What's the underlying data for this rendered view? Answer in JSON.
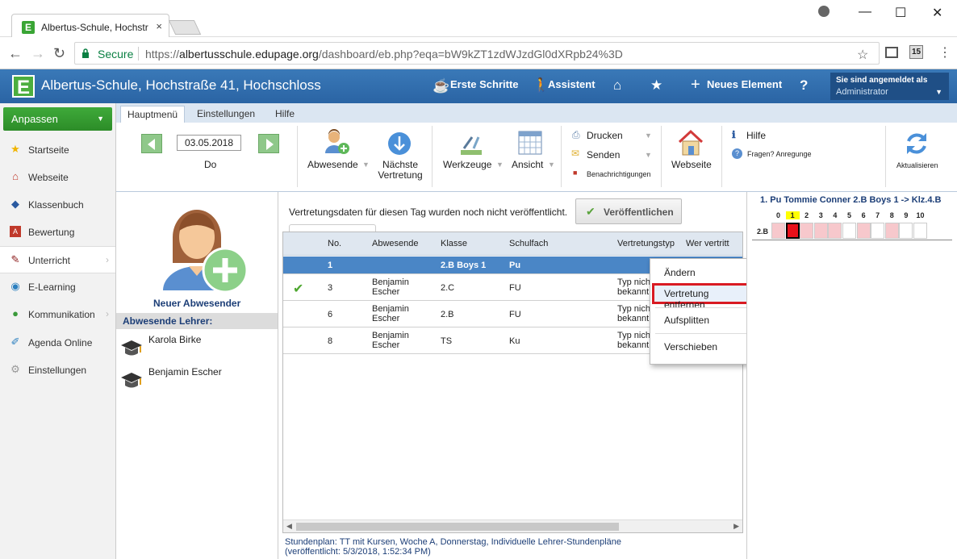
{
  "browser": {
    "tab_title": "Albertus-Schule, Hochstr",
    "tab_close": "×",
    "secure_label": "Secure",
    "url_scheme": "https://",
    "url_host": "albertusschule.edupage.org",
    "url_path": "/dashboard/eb.php?eqa=bW9kZT1zdWJzdGl0dXRpb24%3D",
    "extension_badge": "15",
    "window_controls": [
      "—",
      "☐",
      "✕"
    ]
  },
  "app_header": {
    "school_name": "Albertus-Schule, Hochstraße 41, Hochschloss",
    "logo_letter": "E",
    "nav": [
      "Erste Schritte",
      "Assistent",
      "Neues Element"
    ],
    "login_line1": "Sie sind angemeldet als",
    "login_line2": "Administrator",
    "help_icon": "?"
  },
  "sidebar": {
    "button_label": "Anpassen",
    "items": [
      {
        "label": "Startseite",
        "icon": "star-icon"
      },
      {
        "label": "Webseite",
        "icon": "website-icon"
      },
      {
        "label": "Klassenbuch",
        "icon": "book-icon"
      },
      {
        "label": "Bewertung",
        "icon": "grade-icon"
      },
      {
        "label": "Unterricht",
        "icon": "teaching-icon"
      },
      {
        "label": "E-Learning",
        "icon": "elearning-icon"
      },
      {
        "label": "Kommunikation",
        "icon": "communication-icon"
      },
      {
        "label": "Agenda Online",
        "icon": "agenda-icon"
      },
      {
        "label": "Einstellungen",
        "icon": "settings-icon"
      }
    ]
  },
  "ribbon": {
    "tabs": [
      "Hauptmenü",
      "Einstellungen",
      "Hilfe"
    ],
    "date": "03.05.2018",
    "day": "Do",
    "abwesende": "Abwesende",
    "naechste_line1": "Nächste",
    "naechste_line2": "Vertretung",
    "werkzeuge": "Werkzeuge",
    "ansicht": "Ansicht",
    "drucken": "Drucken",
    "senden": "Senden",
    "benachrichtigungen": "Benachrichtigungen",
    "webseite": "Webseite",
    "hilfe": "Hilfe",
    "fragen": "Fragen? Anregunge",
    "aktualisieren": "Aktualisieren"
  },
  "absent_panel": {
    "new_label": "Neuer Abwesender",
    "header": "Abwesende Lehrer:",
    "teachers": [
      "Karola Birke",
      "Benjamin Escher"
    ]
  },
  "center": {
    "notice": "Vertretungsdaten für diesen Tag wurden noch nicht veröffentlicht.",
    "publish_button": "Veröffentlichen",
    "columns": [
      "No.",
      "Abwesende",
      "Klasse",
      "Schulfach",
      "Vertretungstyp",
      "Wer vertritt"
    ],
    "rows": [
      {
        "no": "1",
        "abwesende_1": "",
        "abwesende_2": "",
        "klasse": "2.B Boys 1",
        "fach": "Pu",
        "typ_1": "",
        "typ_2": "",
        "checked": false,
        "selected": true
      },
      {
        "no": "3",
        "abwesende_1": "Benjamin",
        "abwesende_2": "Escher",
        "klasse": "2.C",
        "fach": "FU",
        "typ_1": "Typ nicht",
        "typ_2": "bekannt",
        "checked": true,
        "selected": false
      },
      {
        "no": "6",
        "abwesende_1": "Benjamin",
        "abwesende_2": "Escher",
        "klasse": "2.B",
        "fach": "FU",
        "typ_1": "Typ nicht",
        "typ_2": "bekannt",
        "checked": false,
        "selected": false
      },
      {
        "no": "8",
        "abwesende_1": "Benjamin",
        "abwesende_2": "Escher",
        "klasse": "TS",
        "fach": "Ku",
        "typ_1": "Typ nicht",
        "typ_2": "bekannt",
        "checked": false,
        "selected": false
      }
    ],
    "footer_line1": "Stundenplan: TT mit Kursen, Woche A, Donnerstag, Individuelle Lehrer-Stundenpläne",
    "footer_line2": "(veröffentlicht: 5/3/2018, 1:52:34 PM)"
  },
  "context_menu": {
    "items": [
      "Ändern",
      "Vertretung entfernen",
      "Aufsplitten",
      "Verschieben"
    ],
    "highlighted": "Vertretung entfernen"
  },
  "right_panel": {
    "title": "1. Pu Tommie Conner 2.B Boys 1 -> Klz.4.B",
    "periods": [
      "0",
      "1",
      "2",
      "3",
      "4",
      "5",
      "6",
      "7",
      "8",
      "9",
      "10"
    ],
    "highlight_period": "1",
    "row_label": "2.B",
    "cell_states": [
      "pink",
      "red",
      "pink",
      "pink",
      "pink",
      "white",
      "pink",
      "white",
      "pink",
      "white",
      "white"
    ]
  },
  "colors": {
    "header_blue": "#2a64a4",
    "green": "#3faa3a",
    "selected_row": "#4a86c6",
    "highlight_red": "#d91a22",
    "cell_pink": "#f7c8cc",
    "cell_red": "#e8101a",
    "period_yellow": "#ffff00"
  }
}
